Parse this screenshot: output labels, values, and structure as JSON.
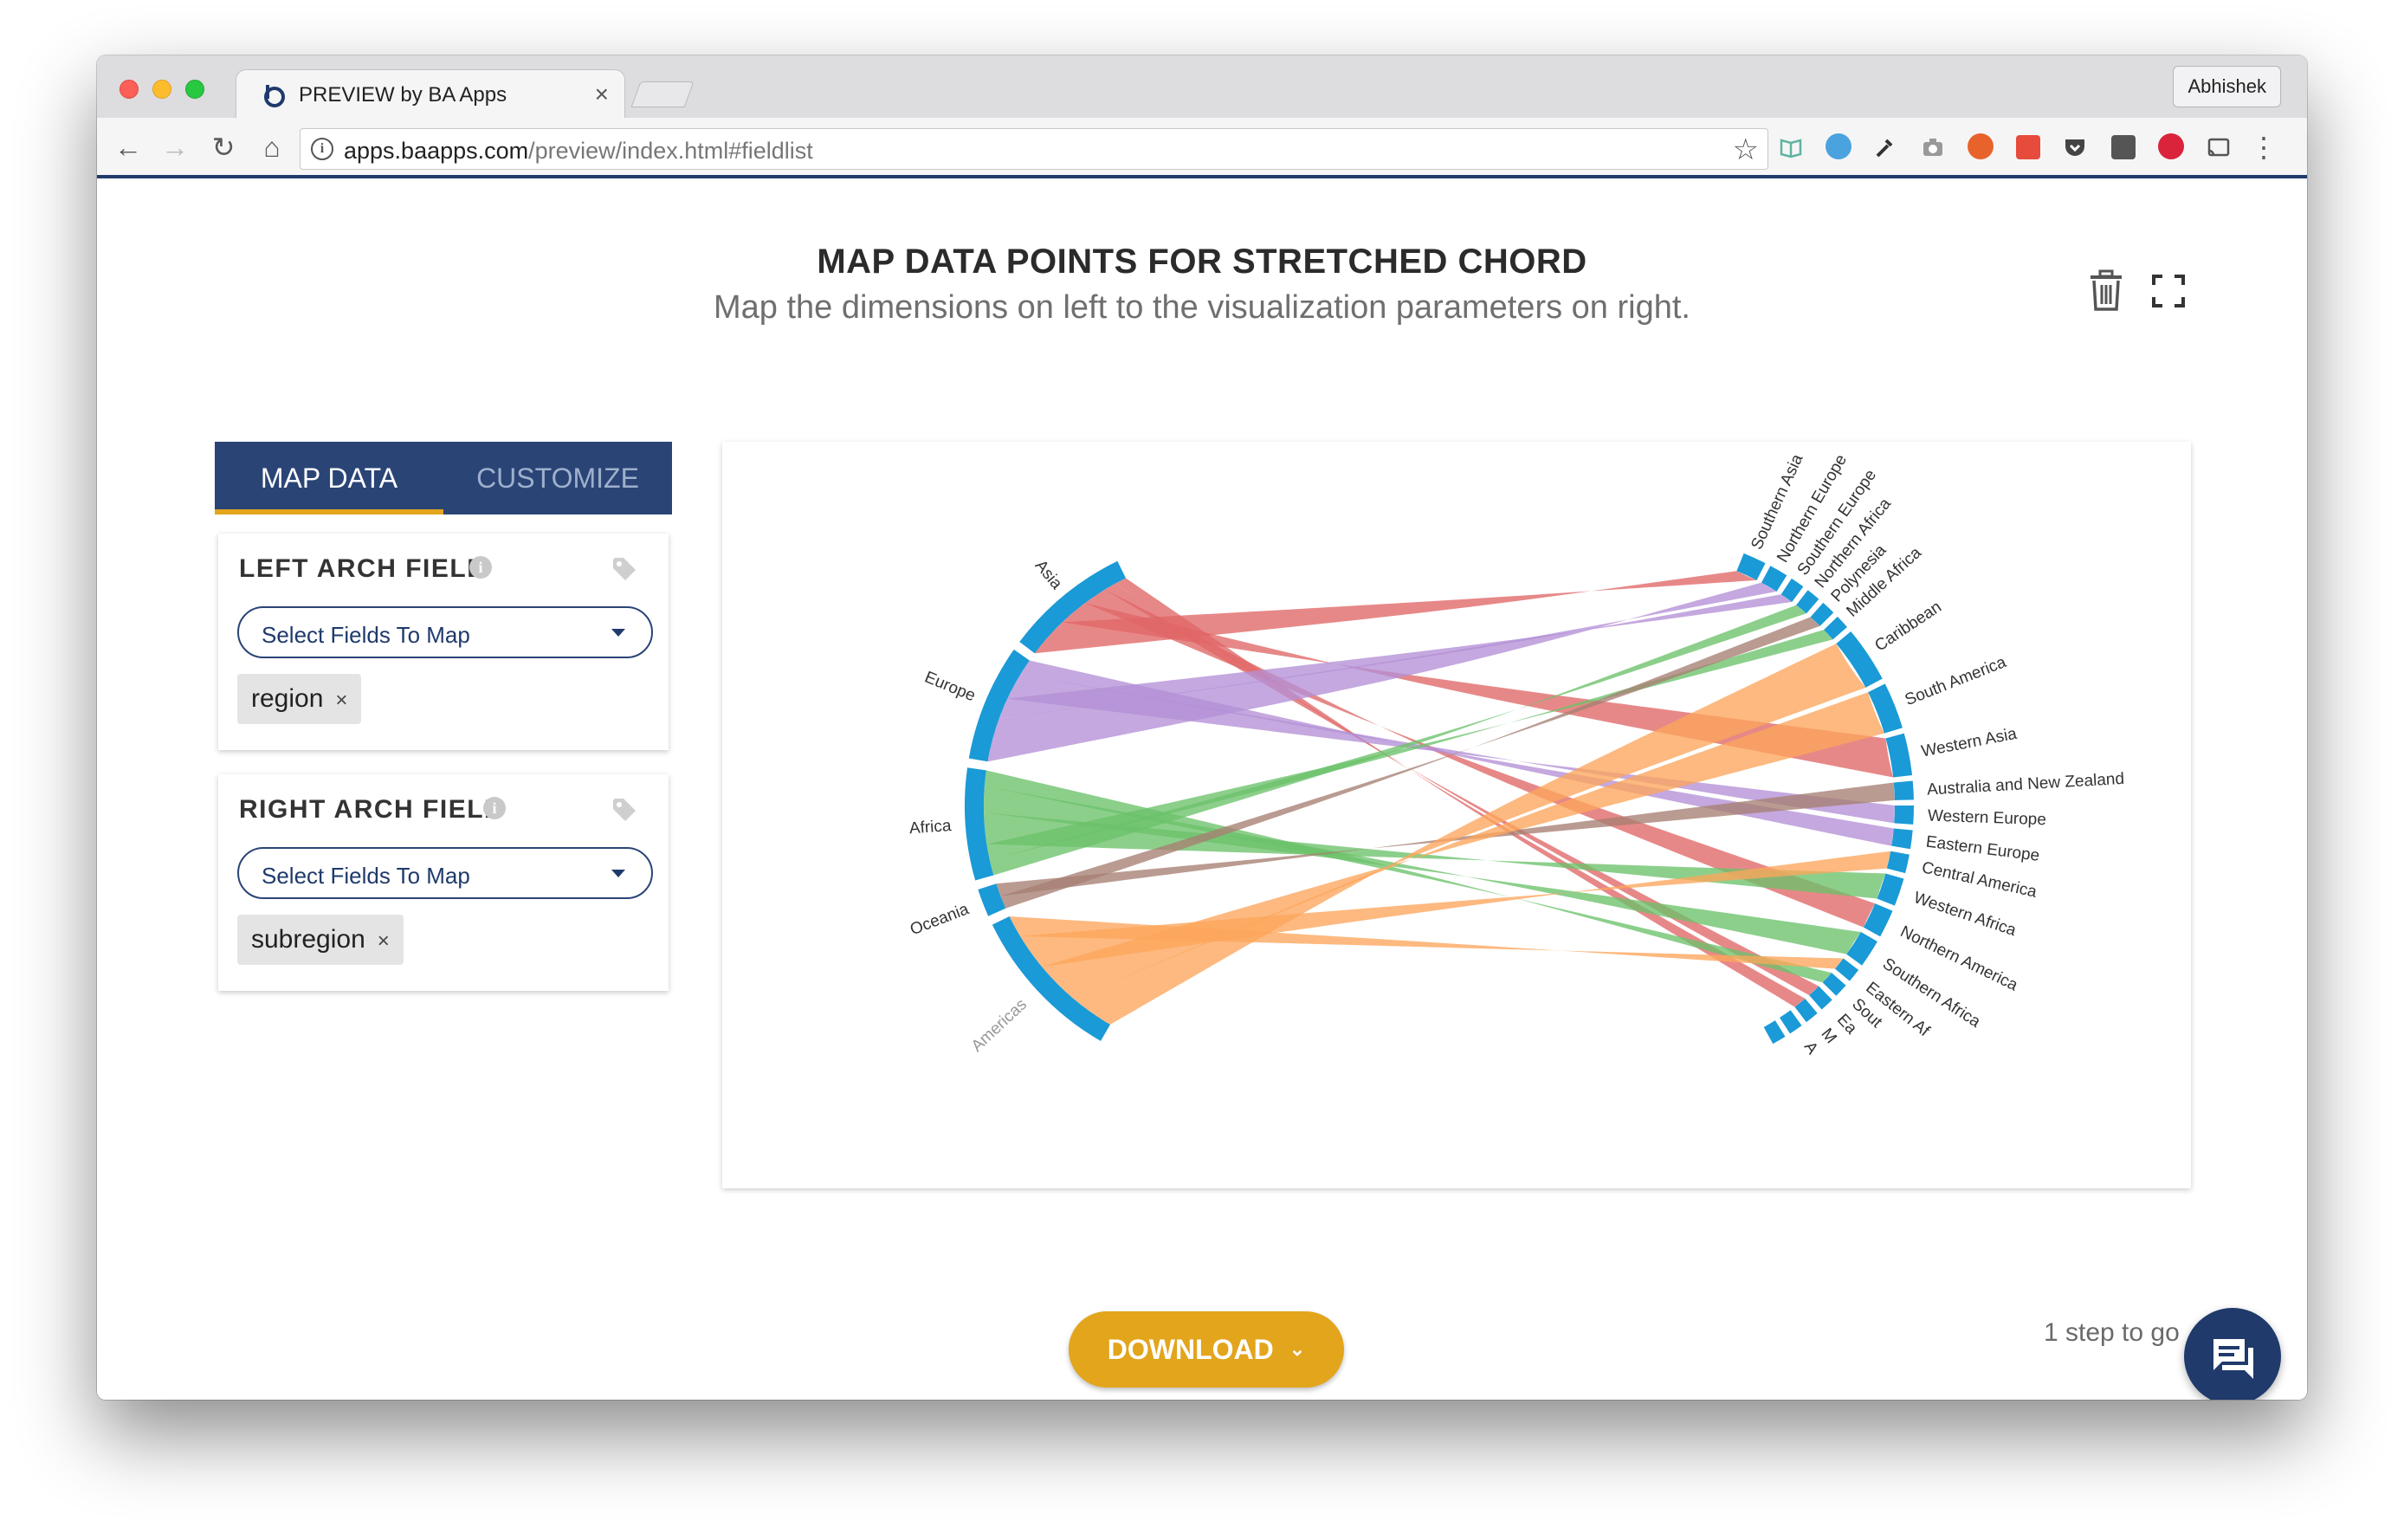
{
  "browser": {
    "tab_title": "PREVIEW by BA Apps",
    "tab_close": "×",
    "profile_name": "Abhishek",
    "url_host": "apps.baapps.com",
    "url_path": "/preview/index.html#fieldlist",
    "nav": {
      "back": "←",
      "forward": "→",
      "reload": "↻",
      "home": "⌂",
      "star": "☆",
      "menu": "⋮"
    }
  },
  "header": {
    "title": "MAP DATA POINTS FOR STRETCHED CHORD",
    "subtitle": "Map the dimensions on left to the visualization parameters on right."
  },
  "panel": {
    "tabs": [
      "MAP DATA",
      "CUSTOMIZE"
    ],
    "left_arch": {
      "label": "LEFT ARCH FIELD",
      "select_placeholder": "Select Fields To Map",
      "chip": "region",
      "chip_remove": "×"
    },
    "right_arch": {
      "label": "RIGHT ARCH FIELD",
      "select_placeholder": "Select Fields To Map",
      "chip": "subregion",
      "chip_remove": "×"
    },
    "info_glyph": "i"
  },
  "chart": {
    "type": "stretched-chord",
    "left_labels": [
      "Asia",
      "Europe",
      "Africa",
      "Oceania",
      "Americas"
    ],
    "right_labels_top": [
      "Southern Asia",
      "Northern Europe",
      "Southern Europe",
      "Northern Africa",
      "Polynesia",
      "Middle Africa",
      "Caribbean",
      "South America",
      "Western Asia",
      "Australia and New Zealand"
    ],
    "right_labels_bottom": [
      "Western Europe",
      "Eastern Europe",
      "Central America",
      "Western Africa",
      "Northern America",
      "Southern Africa",
      "Eastern Af",
      "Sout",
      "Ea",
      "M",
      "A"
    ],
    "colors": {
      "arc": "#1a9ad6",
      "asia": "#e06666",
      "europe": "#b48fd6",
      "africa": "#6cc26a",
      "oceania": "#a67f72",
      "americas": "#fca55b"
    }
  },
  "footer": {
    "download_label": "DOWNLOAD",
    "download_caret": "⌄",
    "steps_text": "1 step to go"
  }
}
